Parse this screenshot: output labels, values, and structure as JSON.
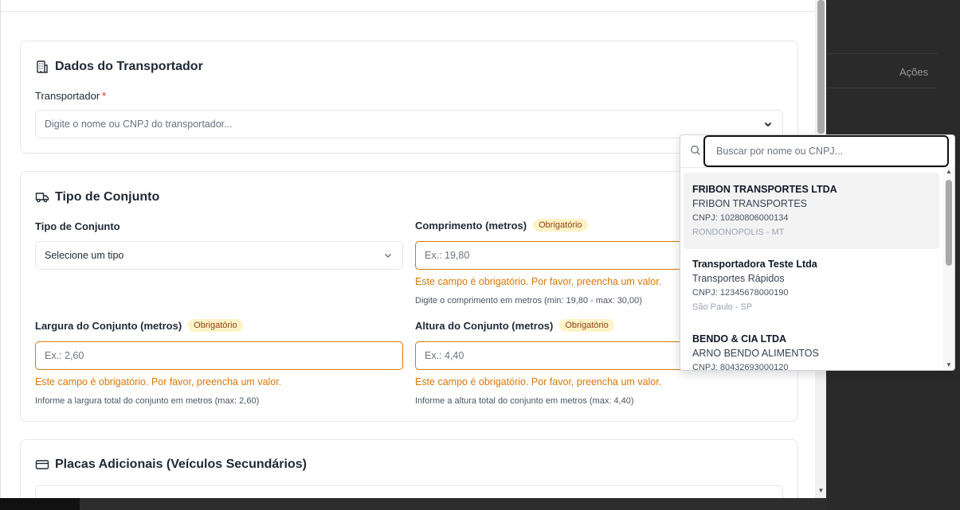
{
  "background": {
    "actions_label": "Ações"
  },
  "transportador_section": {
    "title": "Dados do Transportador",
    "field_label": "Transportador",
    "required_mark": "*",
    "placeholder": "Digite o nome ou CNPJ do transportador..."
  },
  "tipo_section": {
    "title": "Tipo de Conjunto",
    "tipo": {
      "label": "Tipo de Conjunto",
      "value": "Selecione um tipo"
    },
    "comprimento": {
      "label": "Comprimento (metros)",
      "badge": "Obrigatório",
      "placeholder": "Ex.: 19,80",
      "error": "Este campo é obrigatório. Por favor, preencha um valor.",
      "hint": "Digite o comprimento em metros (min: 19,80 - max: 30,00)"
    },
    "largura": {
      "label": "Largura do Conjunto (metros)",
      "badge": "Obrigatório",
      "placeholder": "Ex.: 2,60",
      "error": "Este campo é obrigatório. Por favor, preencha um valor.",
      "hint": "Informe a largura total do conjunto em metros (max: 2,60)"
    },
    "altura": {
      "label": "Altura do Conjunto (metros)",
      "badge": "Obrigatório",
      "placeholder": "Ex.: 4,40",
      "error": "Este campo é obrigatório. Por favor, preencha um valor.",
      "hint": "Informe a altura total do conjunto em metros (max: 4,40)"
    }
  },
  "placas_section": {
    "title": "Placas Adicionais (Veículos Secundários)"
  },
  "dropdown": {
    "search_placeholder": "Buscar por nome ou CNPJ...",
    "options": [
      {
        "name": "FRIBON TRANSPORTES LTDA",
        "trade_name": "FRIBON TRANSPORTES",
        "cnpj": "CNPJ: 10280806000134",
        "location": "RONDONOPOLIS - MT"
      },
      {
        "name": "Transportadora Teste Ltda",
        "trade_name": "Transportes Rápidos",
        "cnpj": "CNPJ: 12345678000190",
        "location": "São Paulo - SP"
      },
      {
        "name": "BENDO & CIA LTDA",
        "trade_name": "ARNO BENDO ALIMENTOS",
        "cnpj": "CNPJ: 80432693000120",
        "location": ""
      }
    ]
  },
  "colors": {
    "error": "#d97706",
    "badge_bg": "#fef3c7",
    "required": "#dc2626"
  }
}
